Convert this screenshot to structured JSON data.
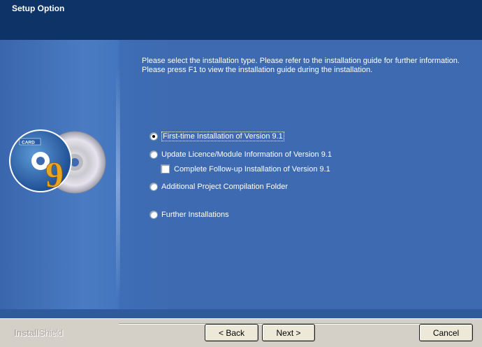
{
  "window": {
    "title": "Setup Option"
  },
  "instructions": {
    "line1": "Please select the installation type. Please refer to the installation guide for further information.",
    "line2": "Please press F1 to view the installation guide during the installation."
  },
  "options": [
    {
      "label": "First-time Installation of Version 9.1",
      "type": "radio",
      "checked": true
    },
    {
      "label": "Update Licence/Module Information of Version 9.1",
      "type": "radio",
      "checked": false
    },
    {
      "label": "Complete Follow-up Installation of Version 9.1",
      "type": "checkbox",
      "checked": false
    },
    {
      "label": "Additional Project Compilation Folder",
      "type": "radio",
      "checked": false
    },
    {
      "label": "Further Installations",
      "type": "radio",
      "checked": false
    }
  ],
  "art": {
    "cd_label": "CARD",
    "cd_number": "9"
  },
  "footer": {
    "brand_bold": "Install",
    "brand_light": "Shield",
    "back_label": "< Back",
    "next_label": "Next >",
    "cancel_label": "Cancel"
  }
}
